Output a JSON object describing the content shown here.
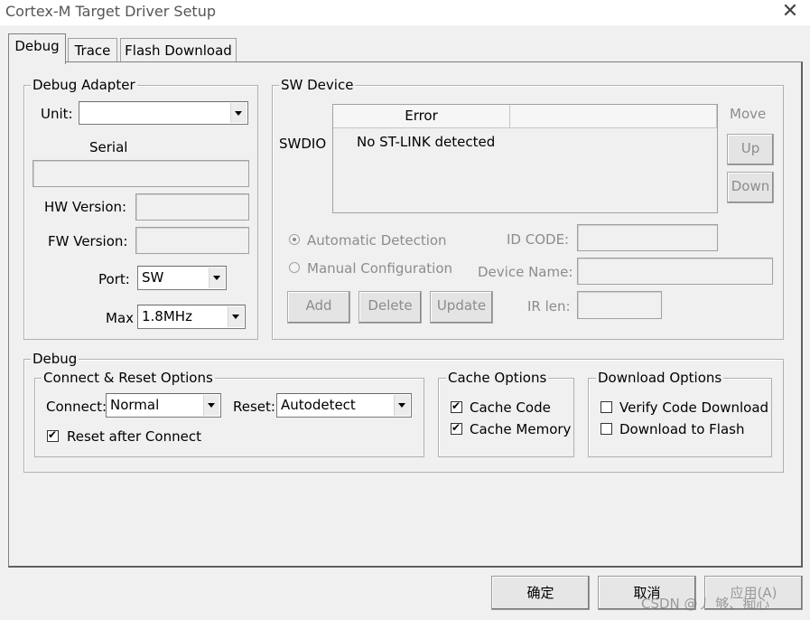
{
  "window": {
    "title": "Cortex-M Target Driver Setup",
    "close_glyph": "✕"
  },
  "tabs": [
    {
      "label": "Debug",
      "active": true
    },
    {
      "label": "Trace",
      "active": false
    },
    {
      "label": "Flash Download",
      "active": false
    }
  ],
  "debug_adapter": {
    "group_label": "Debug Adapter",
    "unit_label": "Unit:",
    "unit_value": "",
    "serial_label": "Serial",
    "serial_value": "",
    "hw_version_label": "HW Version:",
    "hw_version_value": "",
    "fw_version_label": "FW Version:",
    "fw_version_value": "",
    "port_label": "Port:",
    "port_value": "SW",
    "max_label": "Max",
    "max_value": "1.8MHz"
  },
  "sw_device": {
    "group_label": "SW Device",
    "row_label": "SWDIO",
    "col_header_1": "Error",
    "col_header_2": "",
    "row_text": "No ST-LINK detected",
    "move_label": "Move",
    "up_label": "Up",
    "down_label": "Down",
    "auto_detect_label": "Automatic Detection",
    "manual_config_label": "Manual Configuration",
    "selected_mode": "Automatic Detection",
    "add_label": "Add",
    "delete_label": "Delete",
    "update_label": "Update",
    "id_code_label": "ID CODE:",
    "device_name_label": "Device Name:",
    "ir_len_label": "IR len:"
  },
  "debug": {
    "group_label": "Debug",
    "connect_reset": {
      "group_label": "Connect & Reset Options",
      "connect_label": "Connect:",
      "connect_value": "Normal",
      "reset_label": "Reset:",
      "reset_value": "Autodetect",
      "reset_after_connect_label": "Reset after Connect",
      "reset_after_connect_checked": true
    },
    "cache": {
      "group_label": "Cache Options",
      "cache_code_label": "Cache Code",
      "cache_code_checked": true,
      "cache_memory_label": "Cache Memory",
      "cache_memory_checked": true
    },
    "download": {
      "group_label": "Download Options",
      "verify_label": "Verify Code Download",
      "verify_checked": false,
      "download_flash_label": "Download to Flash",
      "download_flash_checked": false
    }
  },
  "footer": {
    "ok_label": "确定",
    "cancel_label": "取消",
    "apply_label": "应用(A)"
  },
  "watermark": "CSDN @丿 够、痴心"
}
